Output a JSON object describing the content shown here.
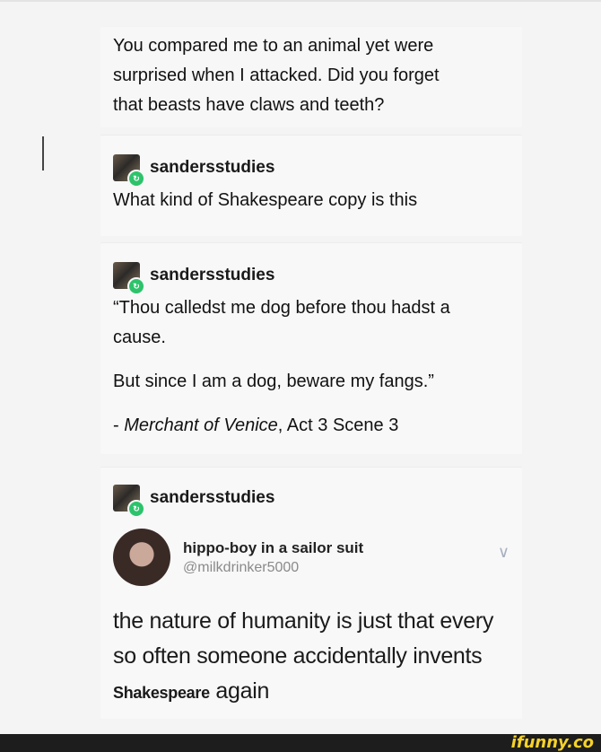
{
  "original_post": {
    "lines": [
      "You compared me to an animal yet were",
      "surprised when I attacked. Did you forget",
      "that beasts have claws and teeth?"
    ]
  },
  "reblogs": [
    {
      "username": "sandersstudies",
      "text": "What kind of Shakespeare copy is this"
    },
    {
      "username": "sandersstudies",
      "paragraphs": [
        "“Thou calledst me dog before thou hadst a cause.",
        "But since I am a dog, beware my fangs.”"
      ],
      "citation_prefix": "- ",
      "citation_italic": "Merchant of Venice",
      "citation_rest": ", Act 3 Scene 3"
    },
    {
      "username": "sandersstudies",
      "tweet": {
        "name": "hippo-boy in a sailor suit",
        "handle": "@milkdrinker5000",
        "text_before": "the nature of humanity is just that every so often someone accidentally invents ",
        "text_bold": "Shakespeare",
        "text_after": " again"
      }
    }
  ],
  "icons": {
    "reblog_badge": "reblog-icon",
    "chevron": "chevron-down-icon"
  },
  "watermark": "ifunny.co",
  "colors": {
    "reblog_green": "#2cc36b",
    "watermark_yellow": "#f6d22a",
    "footer_bg": "#1d1d1d"
  }
}
